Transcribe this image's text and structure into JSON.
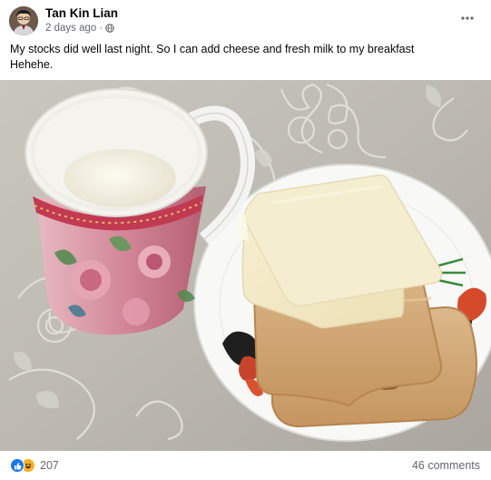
{
  "post": {
    "author": "Tan Kin Lian",
    "timestamp": "2 days ago",
    "separator": "·",
    "audience_icon": "globe-icon",
    "more_icon": "more-options-icon",
    "text_lines": [
      "My stocks did well last night. So I can add cheese and fresh milk to my breakfast",
      "Hehehe."
    ]
  },
  "photo": {
    "subject": "breakfast-photo"
  },
  "footer": {
    "reaction_icons": [
      "like-icon",
      "haha-icon"
    ],
    "reaction_count": "207",
    "comments": "46 comments"
  },
  "colors": {
    "text_primary": "#050505",
    "text_secondary": "#65676b",
    "like_blue": "#1877f2",
    "haha_yellow": "#f7b125"
  }
}
